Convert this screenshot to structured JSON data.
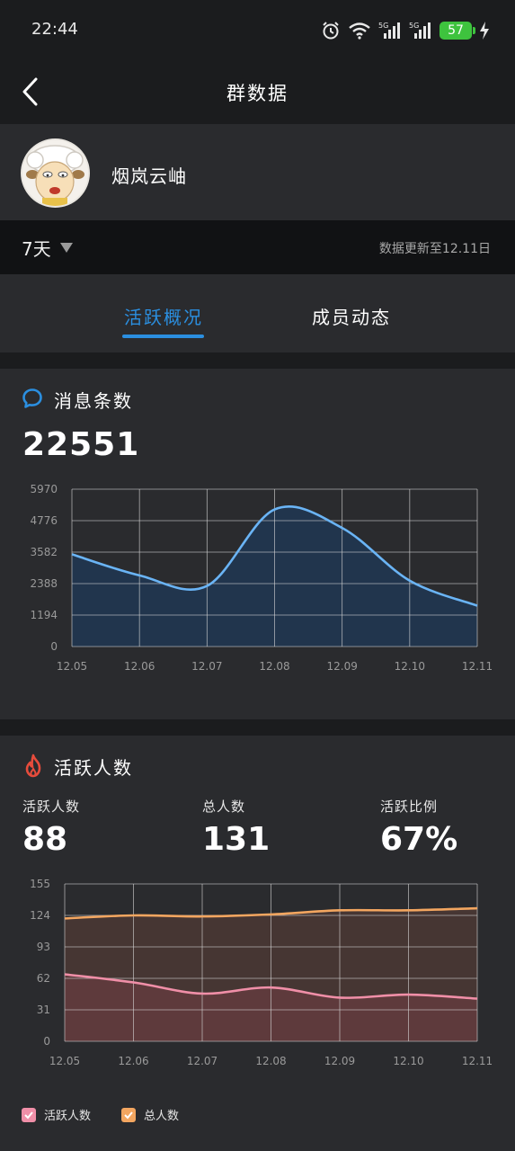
{
  "status_bar": {
    "time": "22:44",
    "battery": "57",
    "icons": [
      "alarm-icon",
      "wifi-icon",
      "signal-5g-icon",
      "signal-5g-icon",
      "battery-icon",
      "charging-icon"
    ]
  },
  "nav": {
    "title": "群数据",
    "back_icon": "chevron-left-icon"
  },
  "group": {
    "name": "烟岚云岫"
  },
  "filter": {
    "range": "7天",
    "update_text": "数据更新至12.11日"
  },
  "tabs": [
    {
      "label": "活跃概况",
      "active": true
    },
    {
      "label": "成员动态",
      "active": false
    }
  ],
  "messages": {
    "title": "消息条数",
    "total": "22551",
    "icon": "chat-bubble-icon",
    "accent": "#2b8fe0"
  },
  "active_members": {
    "title": "活跃人数",
    "icon": "flame-icon",
    "accent": "#e74c3c",
    "stats": [
      {
        "label": "活跃人数",
        "value": "88"
      },
      {
        "label": "总人数",
        "value": "131"
      },
      {
        "label": "活跃比例",
        "value": "67%"
      }
    ],
    "legend": [
      {
        "label": "活跃人数",
        "color": "#f08fa8"
      },
      {
        "label": "总人数",
        "color": "#f3a660"
      }
    ]
  },
  "chart_data": [
    {
      "type": "area",
      "categories": [
        "12.05",
        "12.06",
        "12.07",
        "12.08",
        "12.09",
        "12.10",
        "12.11"
      ],
      "series": [
        {
          "values": [
            3500,
            2700,
            2300,
            5200,
            4500,
            2500,
            1550
          ],
          "color": "#6ab4f5"
        }
      ],
      "y_ticks": [
        "0",
        "1194",
        "2388",
        "3582",
        "4776",
        "5970"
      ],
      "ylim": [
        0,
        5970
      ],
      "grid": true
    },
    {
      "type": "area",
      "categories": [
        "12.05",
        "12.06",
        "12.07",
        "12.08",
        "12.09",
        "12.10",
        "12.11"
      ],
      "series": [
        {
          "name": "总人数",
          "values": [
            121,
            124,
            123,
            125,
            129,
            129,
            131
          ],
          "color": "#f3a660"
        },
        {
          "name": "活跃人数",
          "values": [
            66,
            58,
            47,
            53,
            43,
            46,
            42
          ],
          "color": "#f08fa8"
        }
      ],
      "y_ticks": [
        "0",
        "31",
        "62",
        "93",
        "124",
        "155"
      ],
      "ylim": [
        0,
        155
      ],
      "grid": true,
      "legend": "bottom-left"
    }
  ]
}
